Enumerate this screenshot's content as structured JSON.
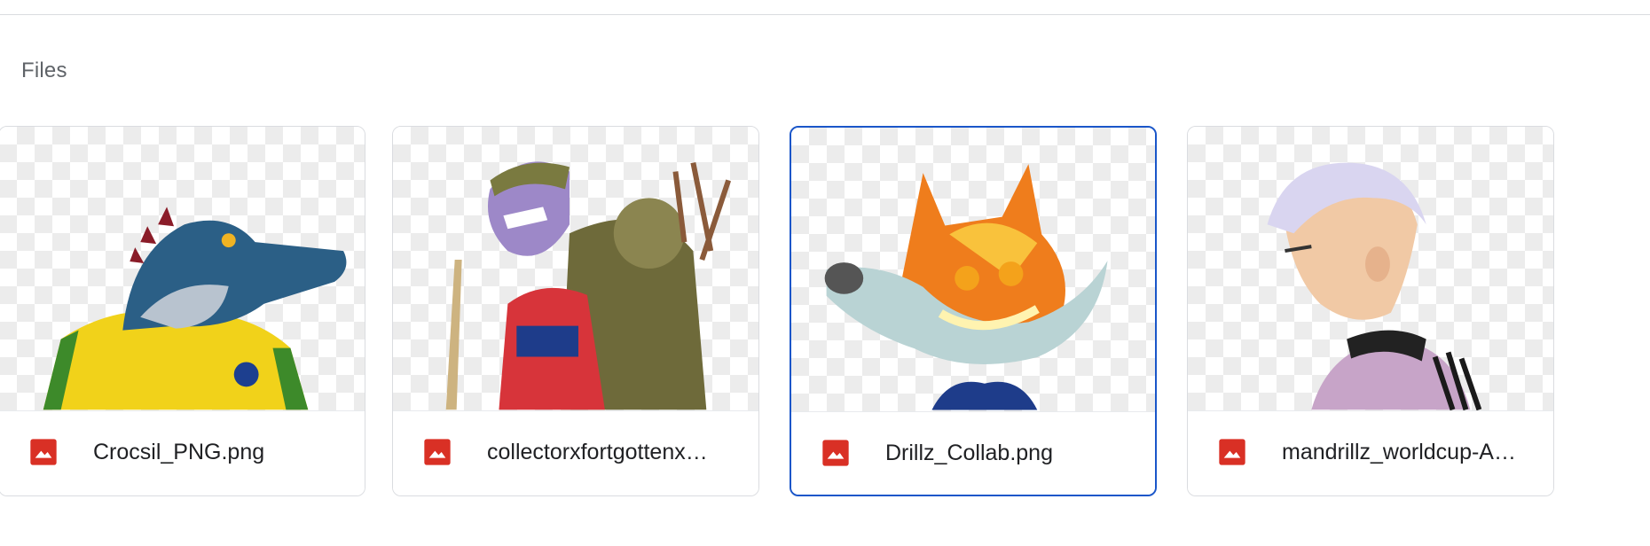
{
  "section": {
    "title": "Files"
  },
  "files": [
    {
      "name": "Crocsil_PNG.png",
      "icon": "image-file-icon",
      "selected": false
    },
    {
      "name": "collectorxfortgottenx…",
      "icon": "image-file-icon",
      "selected": false
    },
    {
      "name": "Drillz_Collab.png",
      "icon": "image-file-icon",
      "selected": true
    },
    {
      "name": "mandrillz_worldcup-A…",
      "icon": "image-file-icon",
      "selected": false
    }
  ],
  "colors": {
    "file_icon": "#d93025",
    "selected_border": "#1a56c9",
    "divider": "#dadce0"
  }
}
